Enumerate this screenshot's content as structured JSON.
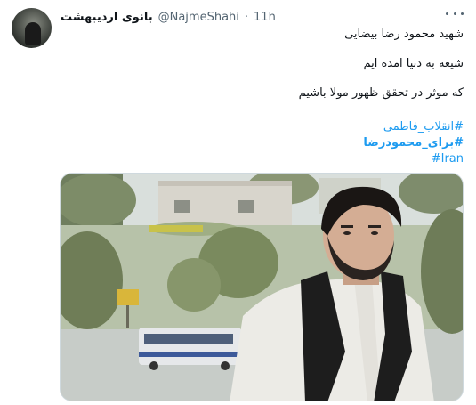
{
  "tweet": {
    "author_name": "بانوی اردیبهشت",
    "handle": "@NajmeShahi",
    "separator": "·",
    "time": "11h",
    "more_icon": "ellipsis-icon",
    "lines": [
      "شهید محمود رضا بیضایی",
      "شیعه به دنیا امده ایم",
      "که موثر در تحقق ظهور مولا باشیم"
    ],
    "hashtags": [
      "#انقلاب_فاطمی",
      "#برای_محمودرضا",
      "#Iran"
    ],
    "link_color": "#1d9bf0"
  }
}
